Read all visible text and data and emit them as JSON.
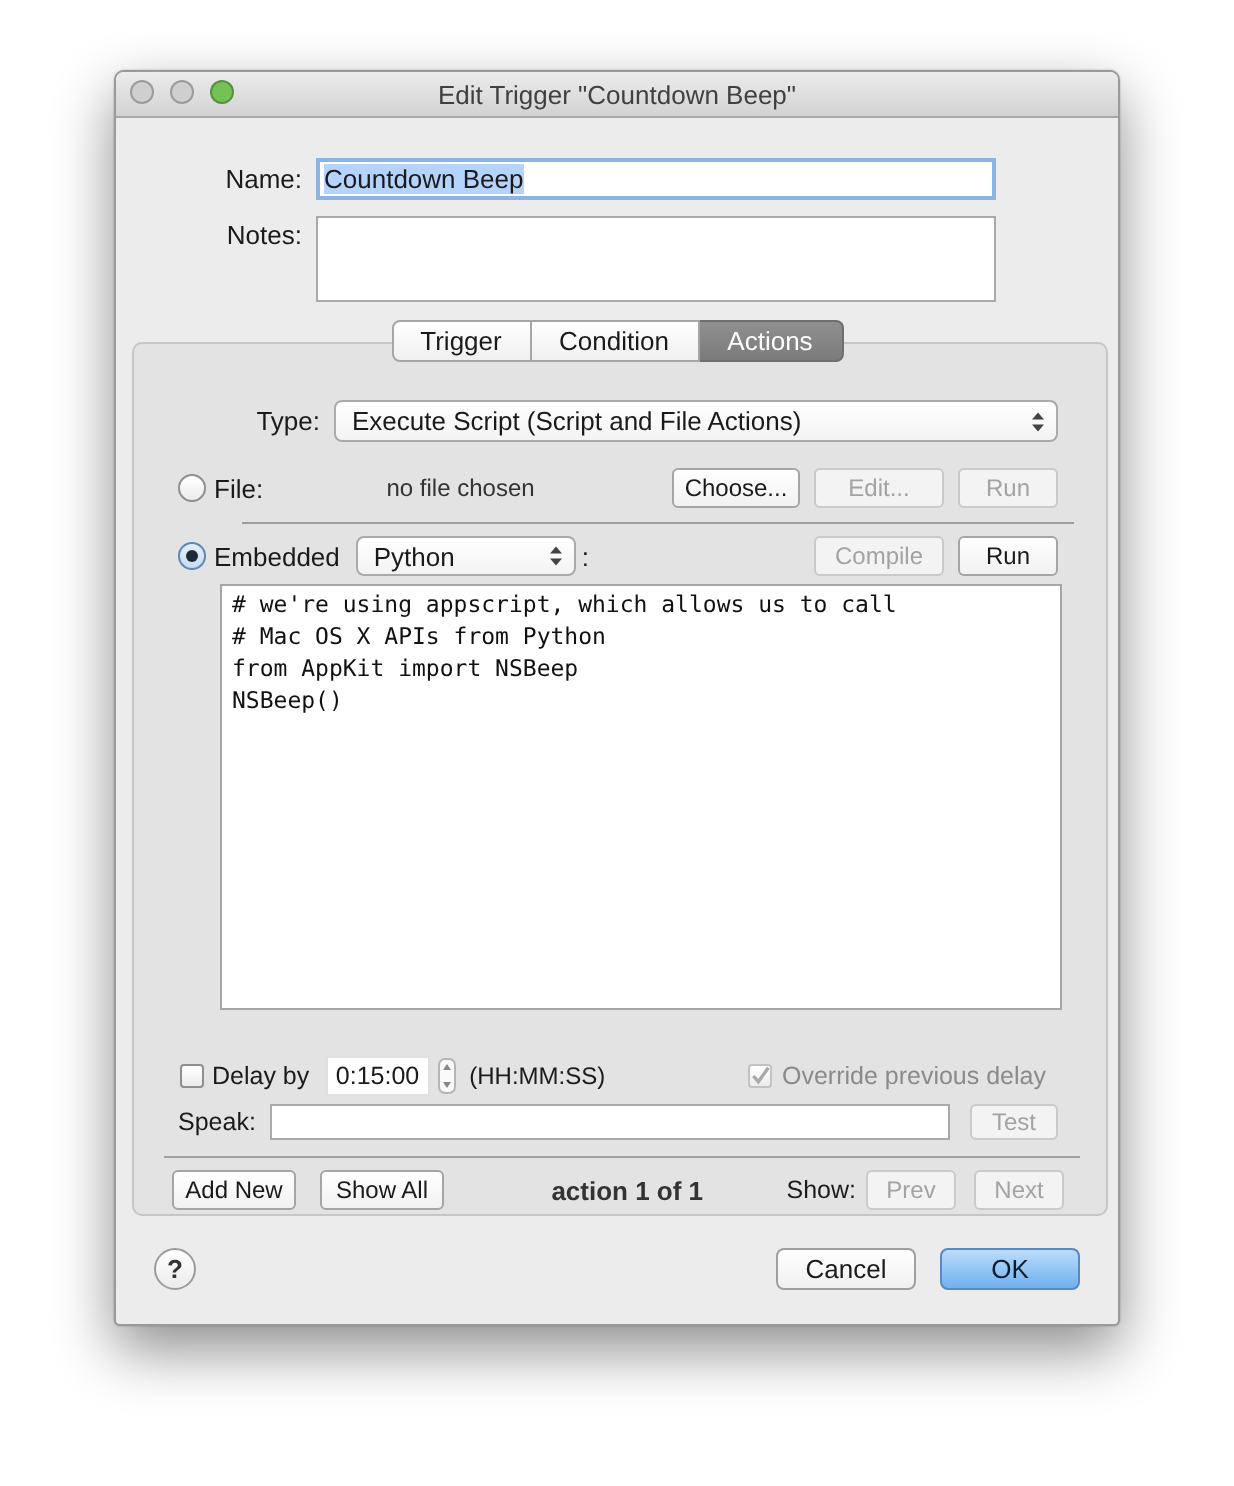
{
  "window": {
    "title": "Edit Trigger \"Countdown Beep\"",
    "buttons": [
      {
        "color": "#cfcfcf"
      },
      {
        "color": "#cfcfcf"
      },
      {
        "color": "#74c155"
      }
    ]
  },
  "name": {
    "label": "Name:",
    "value": "Countdown Beep",
    "focused": true
  },
  "notes": {
    "label": "Notes:"
  },
  "tabs": [
    {
      "label": "Trigger",
      "selected": false
    },
    {
      "label": "Condition",
      "selected": false
    },
    {
      "label": "Actions",
      "selected": true
    }
  ],
  "action": {
    "type": {
      "label": "Type:",
      "value": "Execute Script (Script and File Actions)"
    },
    "file": {
      "label": "File:",
      "selected": false,
      "status": "no file chosen",
      "buttons": [
        {
          "label": "Choose...",
          "disabled": false
        },
        {
          "label": "Edit...",
          "disabled": true
        },
        {
          "label": "Run",
          "disabled": true
        }
      ]
    },
    "embedded": {
      "label": "Embedded",
      "selected": true,
      "language": "Python",
      "suffix": ":",
      "buttons": [
        {
          "label": "Compile",
          "disabled": true
        },
        {
          "label": "Run",
          "disabled": false
        }
      ]
    },
    "script": "# we're using appscript, which allows us to call\n# Mac OS X APIs from Python\nfrom AppKit import NSBeep\nNSBeep()",
    "delay": {
      "label": "Delay by",
      "checked": false,
      "value": "0:15:00",
      "format": "(HH:MM:SS)"
    },
    "override": {
      "label": "Override previous delay",
      "checked": true,
      "disabled": true
    },
    "speak": {
      "label": "Speak:",
      "button": {
        "label": "Test",
        "disabled": true
      }
    },
    "footer": {
      "buttons": [
        {
          "label": "Add New",
          "disabled": false
        },
        {
          "label": "Show All",
          "disabled": false
        }
      ],
      "counter": "action 1 of 1",
      "show_label": "Show:",
      "nav": [
        {
          "label": "Prev",
          "disabled": true
        },
        {
          "label": "Next",
          "disabled": true
        }
      ]
    }
  },
  "help": {
    "label": "?"
  },
  "buttons": [
    {
      "label": "Cancel",
      "kind": "normal"
    },
    {
      "label": "OK",
      "kind": "default"
    }
  ]
}
